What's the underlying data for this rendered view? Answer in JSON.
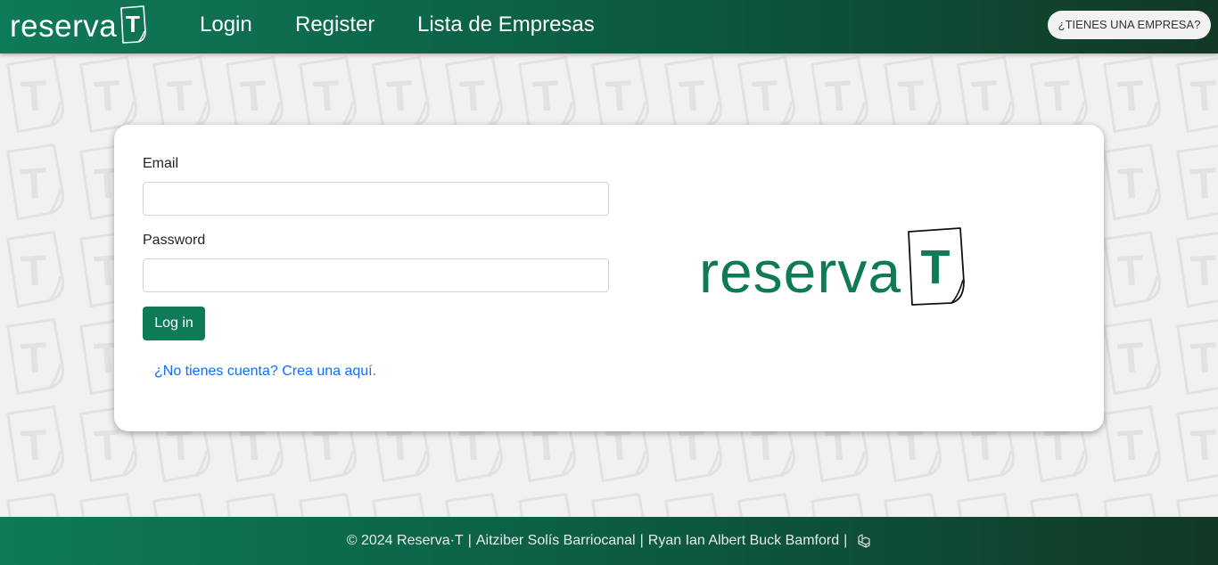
{
  "header": {
    "brand_text": "reserva",
    "brand_letter": "T",
    "nav": [
      {
        "label": "Login"
      },
      {
        "label": "Register"
      },
      {
        "label": "Lista de Empresas"
      }
    ],
    "company_button": "¿TIENES UNA EMPRESA?"
  },
  "login_form": {
    "email_label": "Email",
    "email_value": "",
    "password_label": "Password",
    "password_value": "",
    "submit_label": "Log in",
    "register_link": "¿No tienes cuenta? Crea una aquí."
  },
  "card_logo": {
    "text": "reserva",
    "letter": "T"
  },
  "footer": {
    "copyright": "© 2024 Reserva·T",
    "author1": "Aitziber Solís Barriocanal",
    "author2": "Ryan Ian Albert Buck Bamford",
    "separator": "|",
    "icon": "laravel-icon"
  },
  "colors": {
    "primary": "#0f7a58",
    "header_dark": "#123826",
    "link": "#0d6efd",
    "pattern": "#e3e3e3"
  }
}
